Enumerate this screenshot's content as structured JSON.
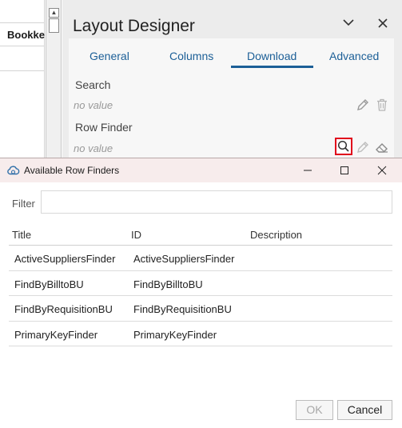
{
  "background": {
    "column_header": "Bookke",
    "scroll_up_glyph": "▲"
  },
  "designer": {
    "title": "Layout Designer",
    "collapse_icon": "chevron-down-icon",
    "close_icon": "close-icon",
    "tabs": [
      {
        "label": "General",
        "selected": false
      },
      {
        "label": "Columns",
        "selected": false
      },
      {
        "label": "Download",
        "selected": true
      },
      {
        "label": "Advanced",
        "selected": false
      }
    ],
    "fields": [
      {
        "label": "Search",
        "value": "no value"
      },
      {
        "label": "Row Finder",
        "value": "no value"
      }
    ],
    "accent": "#1c5f97",
    "highlight_color": "#e0001b"
  },
  "dialog": {
    "title": "Available Row Finders",
    "filter_label": "Filter",
    "filter_value": "",
    "filter_placeholder": "",
    "columns": [
      "Title",
      "ID",
      "Description"
    ],
    "rows": [
      {
        "title": "ActiveSuppliersFinder",
        "id": "ActiveSuppliersFinder",
        "description": ""
      },
      {
        "title": "FindByBilltoBU",
        "id": "FindByBilltoBU",
        "description": ""
      },
      {
        "title": "FindByRequisitionBU",
        "id": "FindByRequisitionBU",
        "description": ""
      },
      {
        "title": "PrimaryKeyFinder",
        "id": "PrimaryKeyFinder",
        "description": ""
      }
    ],
    "ok_label": "OK",
    "ok_disabled": true,
    "cancel_label": "Cancel"
  }
}
